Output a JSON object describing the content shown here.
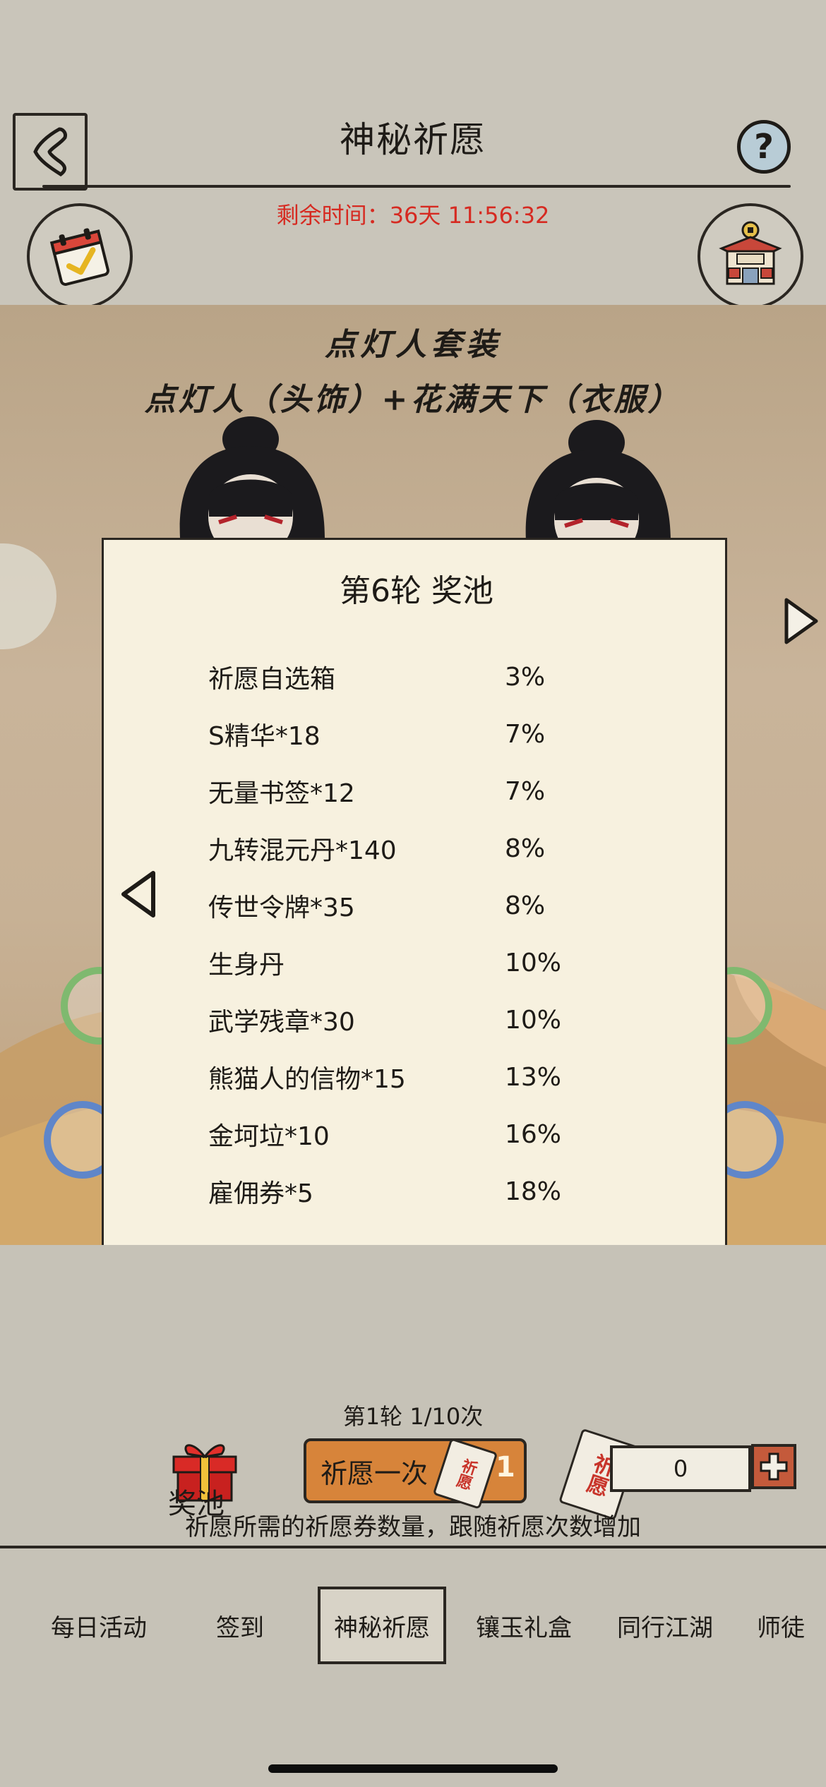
{
  "header": {
    "title": "神秘祈愿",
    "help_label": "?",
    "timer_label": "剩余时间：",
    "timer_value": "36天 11:56:32"
  },
  "scene": {
    "title": "点灯人套装",
    "subtitle": "点灯人（头饰）+花满天下（衣服）"
  },
  "modal": {
    "title": "第6轮 奖池",
    "items": [
      {
        "name": "祈愿自选箱",
        "pct": "3%"
      },
      {
        "name": "S精华*18",
        "pct": "7%"
      },
      {
        "name": "无量书签*12",
        "pct": "7%"
      },
      {
        "name": "九转混元丹*140",
        "pct": "8%"
      },
      {
        "name": "传世令牌*35",
        "pct": "8%"
      },
      {
        "name": "生身丹",
        "pct": "10%"
      },
      {
        "name": "武学残章*30",
        "pct": "10%"
      },
      {
        "name": "熊猫人的信物*15",
        "pct": "13%"
      },
      {
        "name": "金坷垃*10",
        "pct": "16%"
      },
      {
        "name": "雇佣券*5",
        "pct": "18%"
      }
    ]
  },
  "controls": {
    "round_info": "第1轮 1/10次",
    "pool_label": "奖池",
    "wish_label": "祈愿一次",
    "wish_count": "1",
    "ticket_glyph": "祈愿",
    "quantity": "0",
    "hint": "祈愿所需的祈愿券数量，跟随祈愿次数增加"
  },
  "tabs": [
    {
      "label": "每日活动",
      "active": false
    },
    {
      "label": "签到",
      "active": false
    },
    {
      "label": "神秘祈愿",
      "active": true
    },
    {
      "label": "镶玉礼盒",
      "active": false
    },
    {
      "label": "同行江湖",
      "active": false
    },
    {
      "label": "师徒",
      "active": false
    }
  ],
  "colors": {
    "timer": "#d62a21",
    "wish_button": "#d7843a",
    "background": "#c6c2b7",
    "modal_bg": "#f7f1df"
  }
}
